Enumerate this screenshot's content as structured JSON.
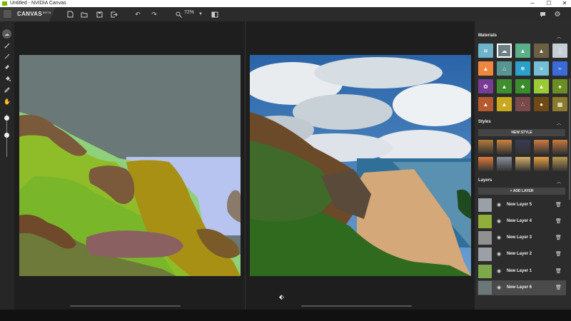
{
  "window": {
    "title": "Untitled - NVIDIA Canvas",
    "minimize": "─",
    "maximize": "☐",
    "close": "✕"
  },
  "app": {
    "name": "CANVAS",
    "badge": "BETA"
  },
  "toolbar": {
    "new_icon": "new-file-icon",
    "open_icon": "open-folder-icon",
    "save_icon": "save-icon",
    "export_icon": "export-icon",
    "undo_icon": "undo-icon",
    "redo_icon": "redo-icon",
    "zoom_icon": "magnifier-icon",
    "zoom_value": "72%",
    "layout_icon": "split-view-icon",
    "feedback_icon": "feedback-icon",
    "settings_icon": "gear-icon"
  },
  "tools": [
    "brush-icon",
    "line-icon",
    "eraser-icon",
    "fill-icon",
    "eyedropper-icon",
    "hand-icon"
  ],
  "brush_settings": {
    "size": 0.5,
    "hardness": 0.85
  },
  "panel": {
    "materials": {
      "title": "Materials",
      "selected": 1,
      "items": [
        {
          "name": "sky",
          "color": "#6db3c9",
          "icon": "≋"
        },
        {
          "name": "cloud",
          "color": "#6d8086",
          "icon": "☁"
        },
        {
          "name": "grass",
          "color": "#5bb08a",
          "icon": "▲"
        },
        {
          "name": "mountain",
          "color": "#6b6045",
          "icon": "▲"
        },
        {
          "name": "fog",
          "color": "#c7cdd4",
          "icon": "░"
        },
        {
          "name": "hill",
          "color": "#f0873f",
          "icon": "▲"
        },
        {
          "name": "building",
          "color": "#589590",
          "icon": "⌂"
        },
        {
          "name": "snow",
          "color": "#2ba1ca",
          "icon": "❄"
        },
        {
          "name": "water",
          "color": "#75bfd6",
          "icon": "≡"
        },
        {
          "name": "sea",
          "color": "#3a6bd8",
          "icon": "≈"
        },
        {
          "name": "flower",
          "color": "#7a3b96",
          "icon": "✿"
        },
        {
          "name": "bush",
          "color": "#3f8f2f",
          "icon": "▲"
        },
        {
          "name": "plant",
          "color": "#3b8c2c",
          "icon": "♣"
        },
        {
          "name": "grass2",
          "color": "#9aca35",
          "icon": "▲"
        },
        {
          "name": "tree",
          "color": "#6b8e23",
          "icon": "♠"
        },
        {
          "name": "dirt",
          "color": "#b55a2f",
          "icon": "▲"
        },
        {
          "name": "sand",
          "color": "#c8a81e",
          "icon": "▲"
        },
        {
          "name": "gravel",
          "color": "#7a4a4a",
          "icon": "∴"
        },
        {
          "name": "rock",
          "color": "#6f4a14",
          "icon": "●"
        },
        {
          "name": "stone",
          "color": "#8a7a2a",
          "icon": "▦"
        }
      ]
    },
    "styles": {
      "title": "Styles",
      "new_label": "NEW STYLE",
      "items": [
        "#b47a3a",
        "#c9853e",
        "#3a3a55",
        "#d07a40",
        "#c8793b",
        "#e07a3a",
        "#8a8f9a",
        "#d4b06a",
        "#e8a040",
        "#b89850"
      ]
    },
    "layers": {
      "title": "Layers",
      "add_label": "+ ADD LAYER",
      "eye_icon": "eye-icon",
      "trash_icon": "trash-icon",
      "items": [
        {
          "name": "New Layer 5",
          "thumb": "#9aa0a6"
        },
        {
          "name": "New Layer 4",
          "thumb": "#8fae3a"
        },
        {
          "name": "New Layer 3",
          "thumb": "#909090"
        },
        {
          "name": "New Layer 2",
          "thumb": "#9aa0a6"
        },
        {
          "name": "New Layer 1",
          "thumb": "#7fa84a"
        },
        {
          "name": "New Layer 6",
          "thumb": "#6b7878"
        }
      ],
      "selected": 5
    }
  }
}
